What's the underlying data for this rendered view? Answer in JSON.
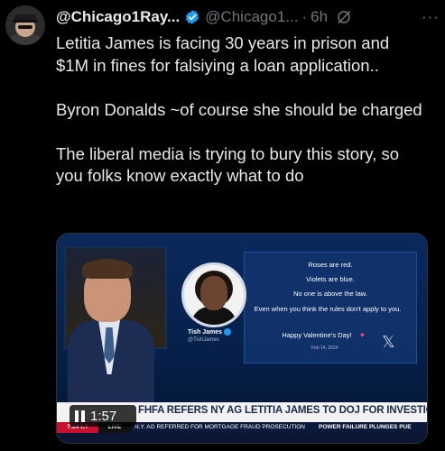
{
  "tweet": {
    "display_name": "@Chicago1Ray...",
    "handle": "@Chicago1...",
    "separator": "·",
    "time": "6h",
    "more": "···",
    "paragraphs": [
      "Letitia James is facing 30 years in prison and $1M in fines for falsiying a loan application..",
      "Byron Donalds ~of course she should be charged",
      "The liberal media is trying to bury this story, so you folks know exactly what to do"
    ]
  },
  "video": {
    "duration": "1:57",
    "headline": "FHFA REFERS NY AG LETITIA JAMES TO DOJ FOR INVESTIGATION",
    "ticker_time": "7:24 CT",
    "ticker_live": "LIVE",
    "ticker_text": "N.Y. AG REFERRED FOR MORTGAGE FRAUD PROSECUTION",
    "ticker_right": "POWER FAILURE PLUNGES PUE",
    "inset_post": {
      "name": "Tish James",
      "handle": "@TishJames",
      "lines": [
        "Roses are red.",
        "Violets are blue.",
        "No one is above the law.",
        "Even when you think the rules don't apply to you.",
        "Happy Valentine's Day!"
      ],
      "date": "Feb 14, 2024"
    }
  },
  "colors": {
    "background": "#000000",
    "text": "#e7e9ea",
    "muted": "#71767b",
    "verified": "#1d9bf0"
  },
  "icons": [
    "avatar",
    "verified-badge-icon",
    "grok-icon",
    "more-icon",
    "pause-icon",
    "x-logo-icon"
  ]
}
